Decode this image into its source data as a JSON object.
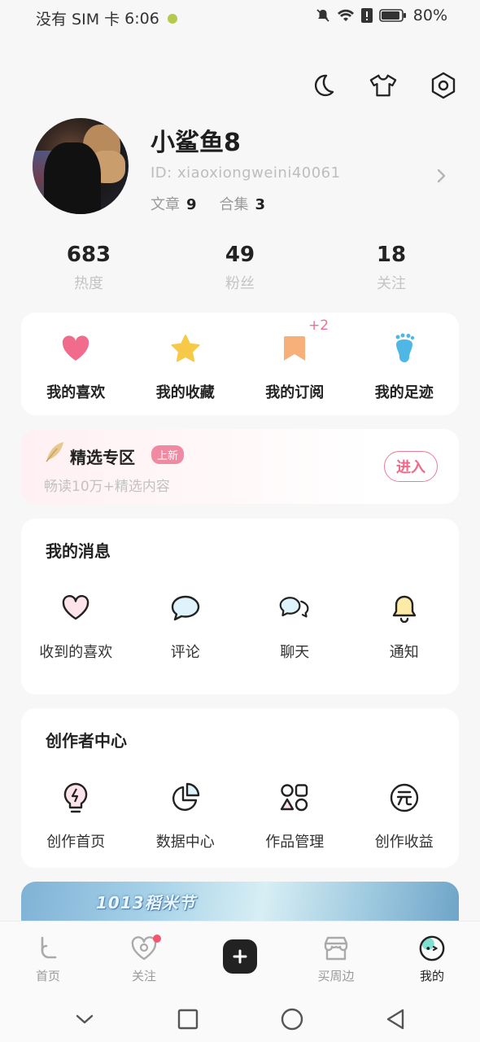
{
  "status_bar": {
    "carrier": "没有 SIM 卡",
    "time": "6:06",
    "battery": "80%"
  },
  "profile": {
    "username": "小鲨鱼8",
    "id_label": "ID:",
    "id_value": "xiaoxiongweini40061",
    "articles_label": "文章",
    "articles_value": "9",
    "collections_label": "合集",
    "collections_value": "3"
  },
  "numbers": [
    {
      "value": "683",
      "label": "热度"
    },
    {
      "value": "49",
      "label": "粉丝"
    },
    {
      "value": "18",
      "label": "关注"
    }
  ],
  "quick_links": [
    {
      "label": "我的喜欢",
      "icon": "heart-icon"
    },
    {
      "label": "我的收藏",
      "icon": "star-icon"
    },
    {
      "label": "我的订阅",
      "icon": "bookmark-icon",
      "badge": "+2"
    },
    {
      "label": "我的足迹",
      "icon": "footprint-icon"
    }
  ],
  "featured": {
    "title": "精选专区",
    "tag": "上新",
    "subtitle": "畅读10万+精选内容",
    "button": "进入"
  },
  "messages": {
    "title": "我的消息",
    "items": [
      {
        "label": "收到的喜欢",
        "icon": "heart-outline-icon"
      },
      {
        "label": "评论",
        "icon": "comment-icon"
      },
      {
        "label": "聊天",
        "icon": "chat-icon"
      },
      {
        "label": "通知",
        "icon": "bell-icon"
      }
    ]
  },
  "creator": {
    "title": "创作者中心",
    "items": [
      {
        "label": "创作首页",
        "icon": "lightbulb-icon"
      },
      {
        "label": "数据中心",
        "icon": "pie-chart-icon"
      },
      {
        "label": "作品管理",
        "icon": "grid-shapes-icon"
      },
      {
        "label": "创作收益",
        "icon": "yuan-coin-icon"
      }
    ]
  },
  "banner": {
    "text": "1013稻米节"
  },
  "bottom_nav": [
    {
      "label": "首页",
      "icon": "home-icon"
    },
    {
      "label": "关注",
      "icon": "follow-heart-icon"
    },
    {
      "label": "",
      "icon": "plus-icon"
    },
    {
      "label": "买周边",
      "icon": "shop-icon"
    },
    {
      "label": "我的",
      "icon": "me-icon"
    }
  ],
  "colors": {
    "accent": "#f0708c",
    "star": "#f7c948",
    "heart": "#f06b8c",
    "bookmark": "#f8b07a",
    "footprint": "#4fb7e6"
  }
}
